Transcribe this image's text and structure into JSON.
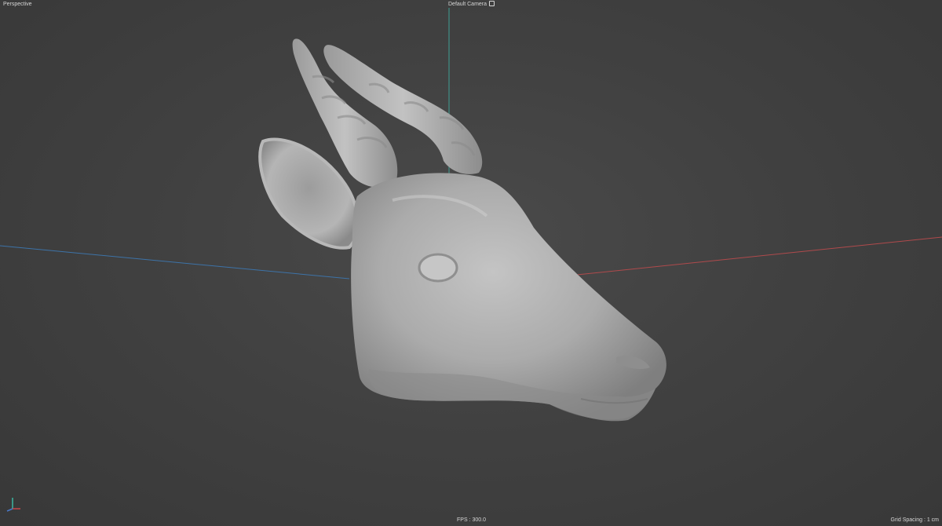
{
  "viewport": {
    "view_name": "Perspective",
    "camera_name": "Default Camera",
    "camera_icon": "camera-icon",
    "fps_label": "FPS : 300.0",
    "grid_spacing_label": "Grid Spacing : 1 cm"
  },
  "gizmo": {
    "icon": "axis-gizmo-icon",
    "x_color": "#c8484a",
    "y_color": "#3bb7a3",
    "z_color": "#4a78c8"
  },
  "scene": {
    "object": "antelope-head-sculpt",
    "object_color": "#a9a9a9",
    "axis_x_color": "#b04a4c",
    "axis_y_color": "#3f9e93",
    "axis_z_color": "#3d73a8"
  }
}
